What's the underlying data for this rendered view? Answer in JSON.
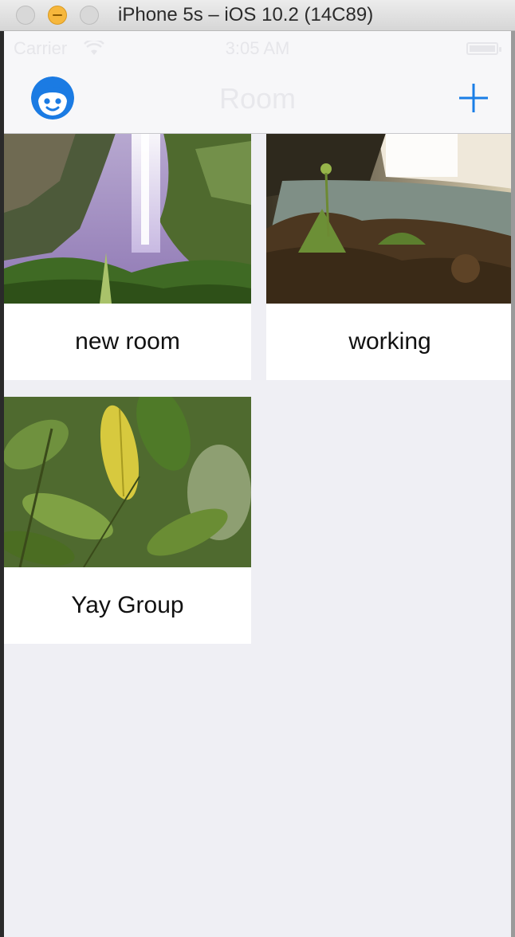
{
  "window": {
    "title": "iPhone 5s – iOS 10.2 (14C89)"
  },
  "status_bar": {
    "carrier": "Carrier",
    "time": "3:05 AM"
  },
  "nav": {
    "title": "Room"
  },
  "rooms": [
    {
      "name": "new room"
    },
    {
      "name": "working"
    },
    {
      "name": "Yay Group"
    }
  ],
  "colors": {
    "accent": "#1a7ee6",
    "background": "#efeff4",
    "nav_bg": "#f7f7f9"
  }
}
